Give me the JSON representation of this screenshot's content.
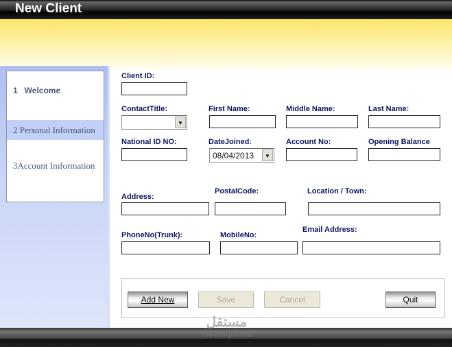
{
  "window": {
    "title": "New Client"
  },
  "nav": {
    "items": [
      {
        "label": "1   Welcome"
      },
      {
        "label": "2 Personal Information"
      },
      {
        "label": "3Account Imformation"
      }
    ]
  },
  "form": {
    "client_id": {
      "label": "Client ID:",
      "value": ""
    },
    "contact_title": {
      "label": "ContactTitle:",
      "value": ""
    },
    "first_name": {
      "label": "First Name:",
      "value": ""
    },
    "middle_name": {
      "label": "Middle Name:",
      "value": ""
    },
    "last_name": {
      "label": "Last Name:",
      "value": ""
    },
    "national_id": {
      "label": "National ID NO:",
      "value": ""
    },
    "date_joined": {
      "label": "DateJoined:",
      "value": "08/04/2013"
    },
    "account_no": {
      "label": "Account No:",
      "value": ""
    },
    "opening_balance": {
      "label": "Opening Balance",
      "value": ""
    },
    "address": {
      "label": "Address:",
      "value": ""
    },
    "postal_code": {
      "label": "PostalCode:",
      "value": ""
    },
    "location": {
      "label": "Location / Town:",
      "value": ""
    },
    "phone": {
      "label": "PhoneNo(Trunk):",
      "value": ""
    },
    "mobile": {
      "label": "MobileNo:",
      "value": ""
    },
    "email": {
      "label": "Email Address:",
      "value": ""
    }
  },
  "buttons": {
    "add_new": "Add New",
    "save": "Save",
    "cancel": "Cancel",
    "quit": "Quit"
  },
  "watermark": {
    "arabic": "مستقل",
    "latin": "mostaql.com"
  }
}
